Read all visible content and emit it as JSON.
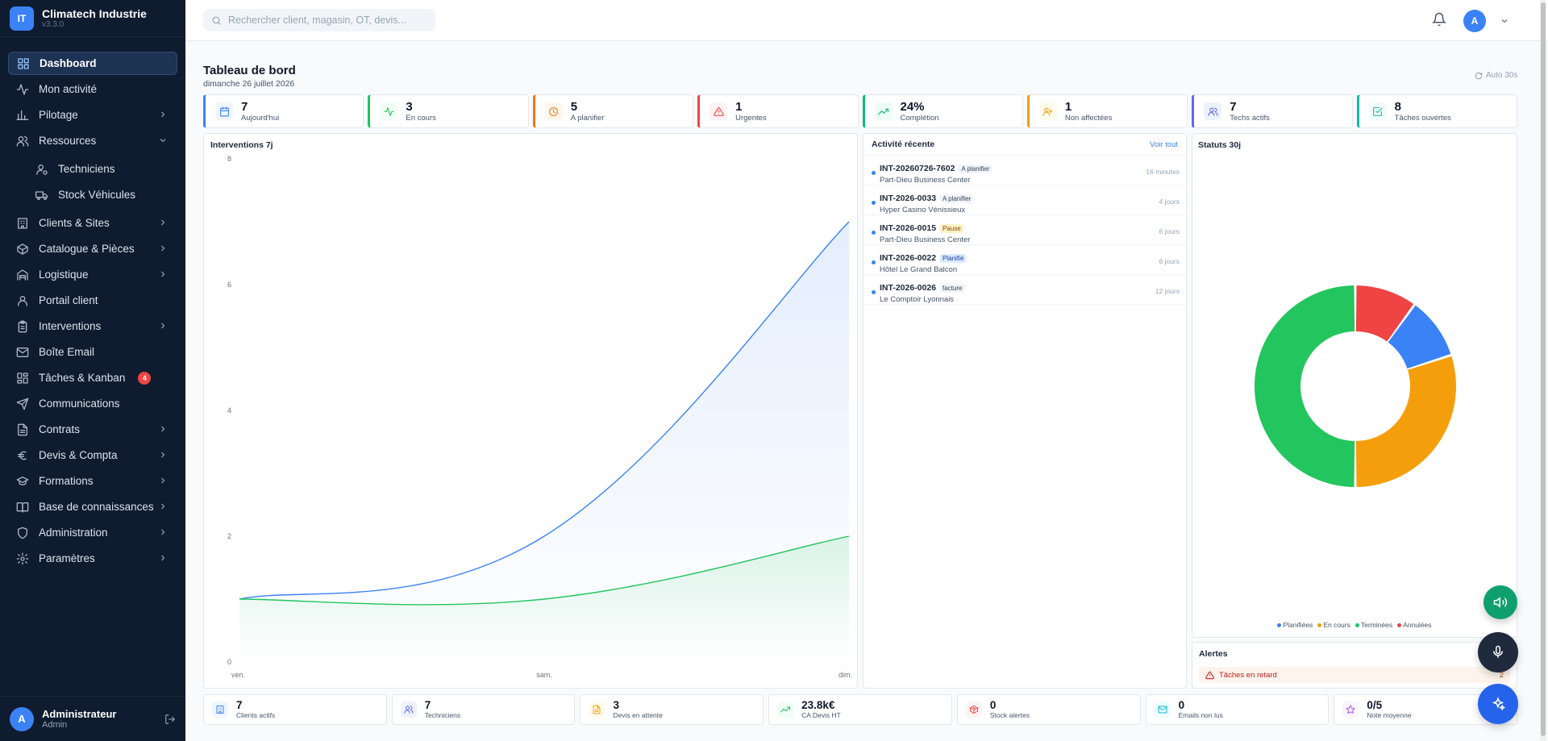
{
  "brand": {
    "logo": "IT",
    "name": "Climatech Industrie",
    "version": "v3.3.0"
  },
  "nav": [
    {
      "label": "Dashboard",
      "icon": "grid-icon",
      "active": true
    },
    {
      "label": "Mon activité",
      "icon": "activity-icon"
    },
    {
      "label": "Pilotage",
      "icon": "bar-chart-icon",
      "chevron": "right"
    },
    {
      "label": "Ressources",
      "icon": "users-icon",
      "chevron": "down"
    },
    {
      "label": "Techniciens",
      "icon": "user-gear-icon",
      "sub": true
    },
    {
      "label": "Stock Véhicules",
      "icon": "truck-icon",
      "sub": true
    },
    {
      "label": "Clients & Sites",
      "icon": "building-icon",
      "chevron": "right"
    },
    {
      "label": "Catalogue & Pièces",
      "icon": "box-icon",
      "chevron": "right"
    },
    {
      "label": "Logistique",
      "icon": "warehouse-icon",
      "chevron": "right"
    },
    {
      "label": "Portail client",
      "icon": "user-icon"
    },
    {
      "label": "Interventions",
      "icon": "clipboard-icon",
      "chevron": "right"
    },
    {
      "label": "Boîte Email",
      "icon": "mail-icon"
    },
    {
      "label": "Tâches & Kanban",
      "icon": "kanban-icon",
      "badge": "4"
    },
    {
      "label": "Communications",
      "icon": "send-icon"
    },
    {
      "label": "Contrats",
      "icon": "file-icon",
      "chevron": "right"
    },
    {
      "label": "Devis & Compta",
      "icon": "euro-icon",
      "chevron": "right"
    },
    {
      "label": "Formations",
      "icon": "graduation-icon",
      "chevron": "right"
    },
    {
      "label": "Base de connaissances",
      "icon": "book-icon",
      "chevron": "right"
    },
    {
      "label": "Administration",
      "icon": "shield-icon",
      "chevron": "right"
    },
    {
      "label": "Paramètres",
      "icon": "gear-icon",
      "chevron": "right"
    }
  ],
  "user": {
    "initial": "A",
    "name": "Administrateur",
    "role": "Admin"
  },
  "topbar": {
    "search_placeholder": "Rechercher client, magasin, OT, devis...",
    "avatar": "A"
  },
  "page": {
    "title": "Tableau de bord",
    "date": "dimanche 26 juillet 2026",
    "auto_refresh": "Auto 30s"
  },
  "stats": [
    {
      "value": "7",
      "label": "Aujourd'hui",
      "icon": "calendar-icon",
      "color": "#3b82f6",
      "bg": "#eff6ff"
    },
    {
      "value": "3",
      "label": "En cours",
      "icon": "activity-icon",
      "color": "#22c55e",
      "bg": "#f0fdf4"
    },
    {
      "value": "5",
      "label": "A planifier",
      "icon": "clock-icon",
      "color": "#f97316",
      "bg": "#fff7ed"
    },
    {
      "value": "1",
      "label": "Urgentes",
      "icon": "warning-icon",
      "color": "#ef4444",
      "bg": "#fef2f2"
    },
    {
      "value": "24%",
      "label": "Complétion",
      "icon": "trend-up-icon",
      "color": "#10b981",
      "bg": "#ecfdf5"
    },
    {
      "value": "1",
      "label": "Non affectées",
      "icon": "user-plus-icon",
      "color": "#f59e0b",
      "bg": "#fffbeb"
    },
    {
      "value": "7",
      "label": "Techs actifs",
      "icon": "users-icon",
      "color": "#6366f1",
      "bg": "#eef2ff"
    },
    {
      "value": "8",
      "label": "Tâches ouvertes",
      "icon": "check-square-icon",
      "color": "#14b8a6",
      "bg": "#f0fdfa"
    }
  ],
  "chart_data": [
    {
      "type": "area",
      "title": "Interventions 7j",
      "categories": [
        "ven.",
        "sam.",
        "dim."
      ],
      "ylim": [
        0,
        8
      ],
      "yticks": [
        0,
        2,
        4,
        6,
        8
      ],
      "grid": false,
      "series": [
        {
          "values": [
            1,
            2,
            7
          ],
          "color": "#3b82f6"
        },
        {
          "values": [
            1,
            1,
            2
          ],
          "color": "#22c55e"
        }
      ]
    },
    {
      "type": "pie",
      "title": "Statuts 30j",
      "legend": "bottom",
      "labels": [
        "Planifiées",
        "En cours",
        "Terminées",
        "Annulées"
      ],
      "values": [
        10,
        30,
        50,
        10
      ],
      "colors": [
        "#3b82f6",
        "#f59e0b",
        "#22c55e",
        "#ef4444"
      ]
    }
  ],
  "activity": {
    "title": "Activité récente",
    "link": "Voir tout",
    "items": [
      {
        "ref": "INT-20260726-7602",
        "tag": "A planifier",
        "tag_class": "",
        "site": "Part-Dieu Business Center",
        "time": "16 minutes"
      },
      {
        "ref": "INT-2026-0033",
        "tag": "A planifier",
        "tag_class": "",
        "site": "Hyper Casino Vénissieux",
        "time": "4 jours"
      },
      {
        "ref": "INT-2026-0015",
        "tag": "Pause",
        "tag_class": "pause",
        "site": "Part-Dieu Business Center",
        "time": "6 jours"
      },
      {
        "ref": "INT-2026-0022",
        "tag": "Planifié",
        "tag_class": "planifie",
        "site": "Hôtel Le Grand Balcon",
        "time": "6 jours"
      },
      {
        "ref": "INT-2026-0026",
        "tag": "facture",
        "tag_class": "",
        "site": "Le Comptoir Lyonnais",
        "time": "12 jours"
      }
    ]
  },
  "alerts": {
    "title": "Alertes",
    "items": [
      {
        "label": "Tâches en retard",
        "count": "2"
      }
    ]
  },
  "bottom_stats": [
    {
      "value": "7",
      "label": "Clients actifs",
      "icon": "building-icon",
      "color": "#3b82f6",
      "bg": "#eff6ff"
    },
    {
      "value": "7",
      "label": "Techniciens",
      "icon": "users-icon",
      "color": "#6366f1",
      "bg": "#eef2ff"
    },
    {
      "value": "3",
      "label": "Devis en attente",
      "icon": "file-icon",
      "color": "#f59e0b",
      "bg": "#fffbeb"
    },
    {
      "value": "23.8k€",
      "label": "CA Devis HT",
      "icon": "trend-up-icon",
      "color": "#22c55e",
      "bg": "#f0fdf4"
    },
    {
      "value": "0",
      "label": "Stock alertes",
      "icon": "package-icon",
      "color": "#ef4444",
      "bg": "#fef2f2"
    },
    {
      "value": "0",
      "label": "Emails non lus",
      "icon": "mail-icon",
      "color": "#06b6d4",
      "bg": "#ecfeff"
    },
    {
      "value": "0/5",
      "label": "Note moyenne",
      "icon": "star-icon",
      "color": "#a855f7",
      "bg": "#faf5ff"
    }
  ],
  "fabs": {
    "speaker": {
      "icon": "speaker-icon",
      "color": "#0f9f6e"
    },
    "mic": {
      "icon": "mic-icon",
      "color": "#1f2a3c"
    },
    "assistant": {
      "icon": "sparkle-icon",
      "color": "#2563eb"
    }
  }
}
